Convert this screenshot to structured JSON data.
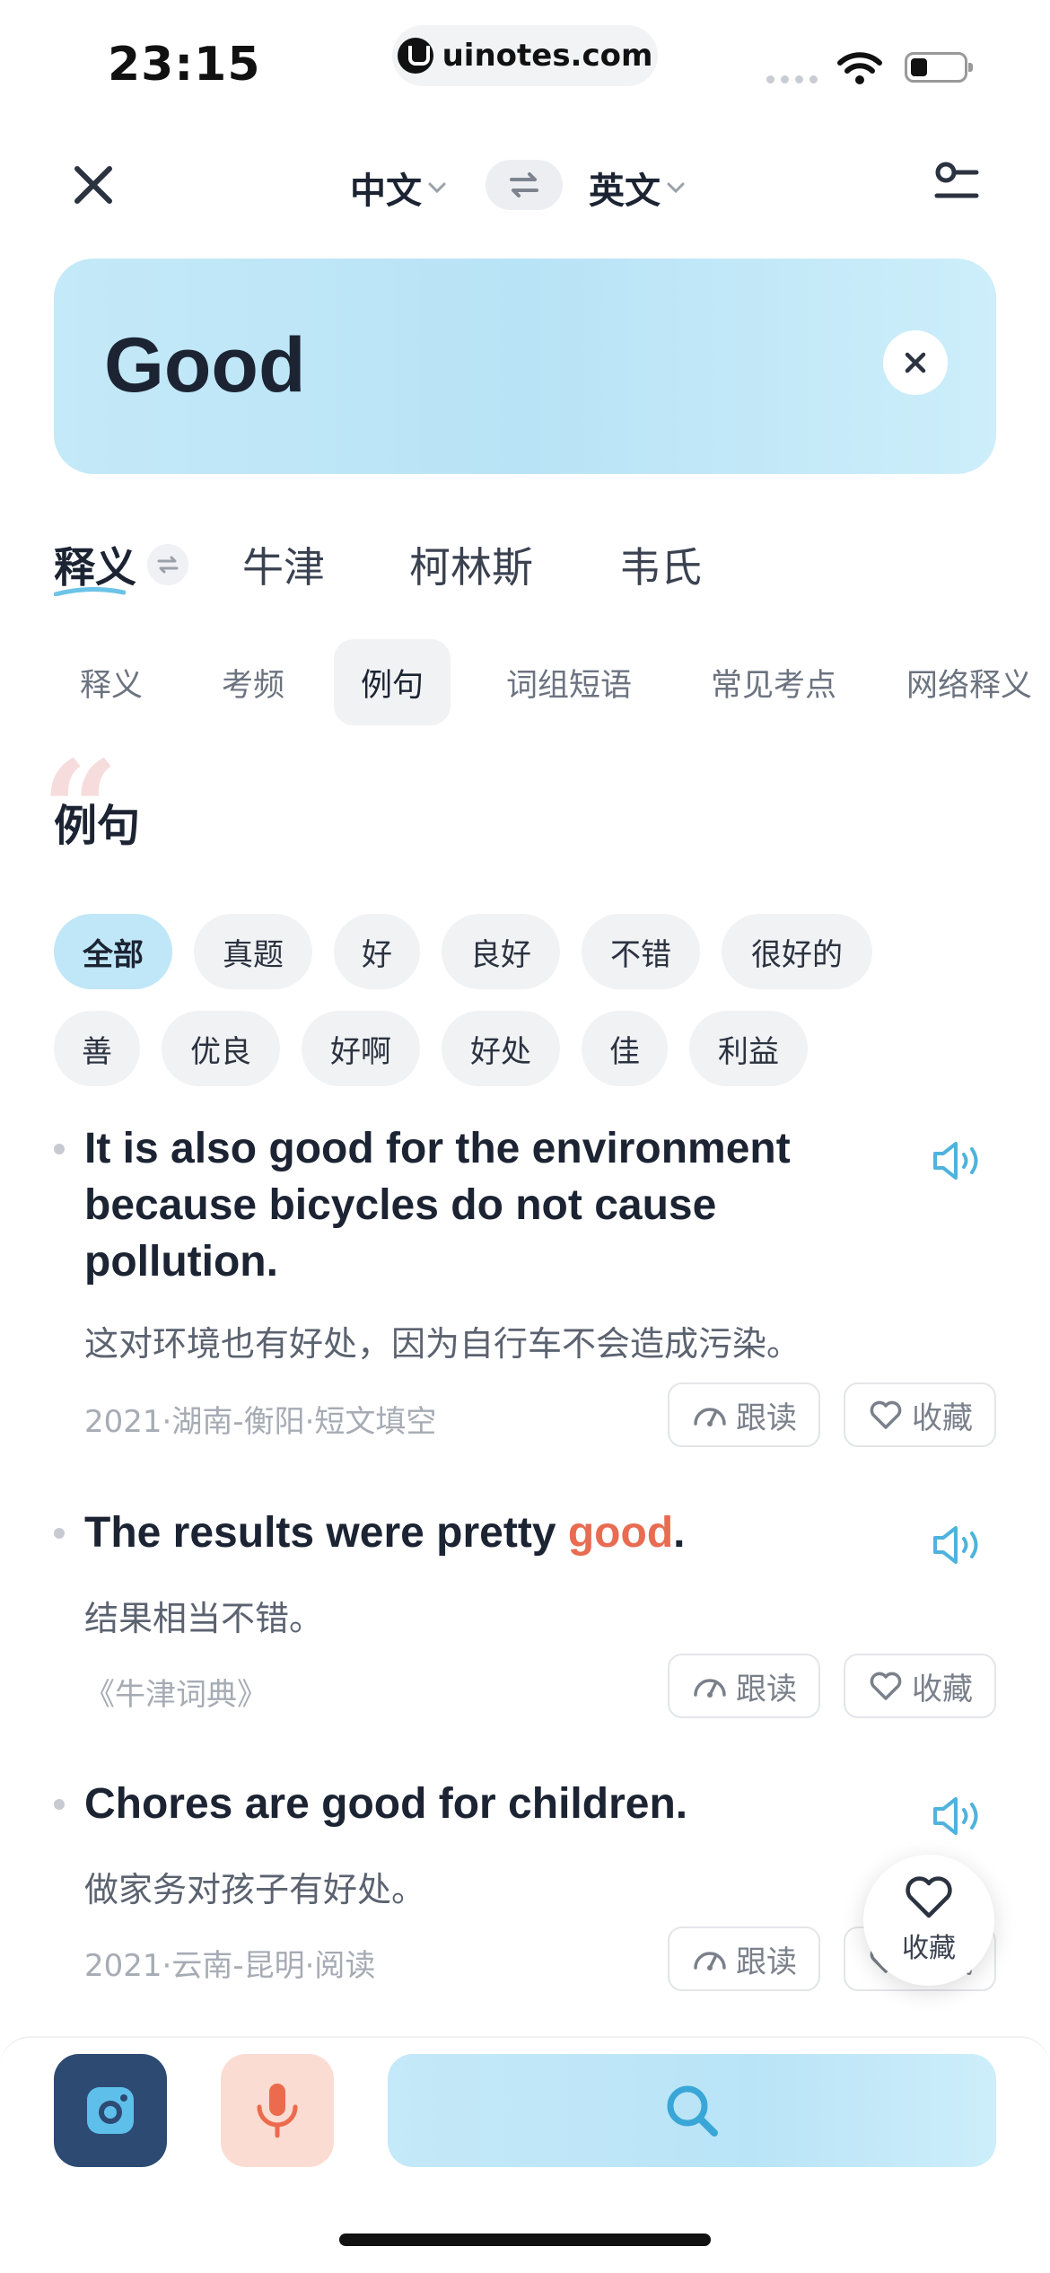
{
  "status_bar": {
    "time": "23:15",
    "url": "uinotes.com"
  },
  "top_nav": {
    "lang_from": "中文",
    "lang_to": "英文"
  },
  "search": {
    "query": "Good"
  },
  "dict_tabs": [
    "释义",
    "牛津",
    "柯林斯",
    "韦氏"
  ],
  "section_tabs": [
    "释义",
    "考频",
    "例句",
    "词组短语",
    "常见考点",
    "网络释义"
  ],
  "section_active": "例句",
  "section_heading": "例句",
  "filter_chips_row1": [
    "全部",
    "真题",
    "好",
    "良好",
    "不错",
    "很好的"
  ],
  "filter_chips_row2": [
    "善",
    "优良",
    "好啊",
    "好处",
    "佳",
    "利益"
  ],
  "filter_active": "全部",
  "examples": [
    {
      "en_line1": "It is also good for the environment",
      "en_line2": "because bicycles do not cause",
      "en_line3": "pollution.",
      "zh": "这对环境也有好处，因为自行车不会造成污染。",
      "source": "2021·湖南-衡阳·短文填空",
      "follow_label": "跟读",
      "fav_label": "收藏"
    },
    {
      "en_before": "The results were pretty ",
      "en_highlight": "good",
      "en_after": ".",
      "zh": "结果相当不错。",
      "source": "《牛津词典》",
      "follow_label": "跟读",
      "fav_label": "收藏"
    },
    {
      "en_line1": "Chores are good for children.",
      "zh": "做家务对孩子有好处。",
      "source": "2021·云南-昆明·阅读",
      "follow_label": "跟读",
      "fav_label": "收藏"
    }
  ],
  "floating_favorite": {
    "label": "收藏"
  },
  "colors": {
    "accent_blue": "#4fb3dc",
    "highlight": "#e86c52",
    "camera_bg": "#2d4a73",
    "mic_bg": "#fbdcd2"
  },
  "icons": [
    "close-icon",
    "chevron-down-icon",
    "swap-icon",
    "settings-icon",
    "clear-icon",
    "speaker-icon",
    "follow-read-icon",
    "heart-icon",
    "camera-icon",
    "microphone-icon",
    "search-icon"
  ]
}
